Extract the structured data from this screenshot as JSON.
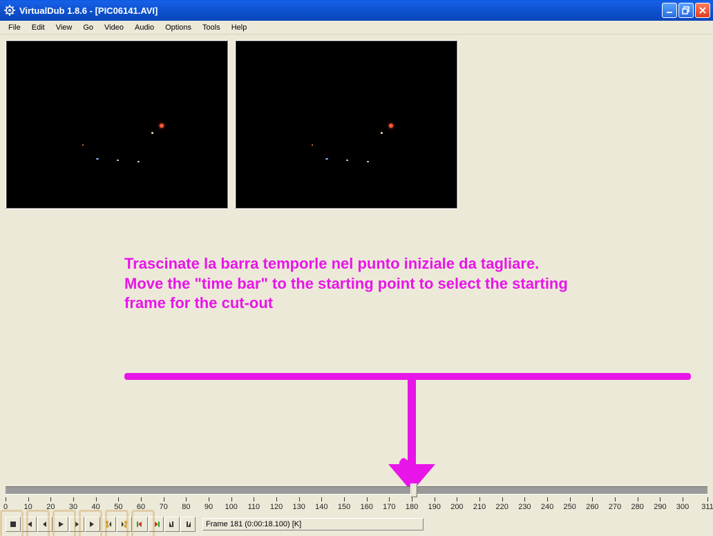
{
  "window": {
    "title": "VirtualDub 1.8.6 - [PIC06141.AVI]"
  },
  "menu": {
    "items": [
      "File",
      "Edit",
      "View",
      "Go",
      "Video",
      "Audio",
      "Options",
      "Tools",
      "Help"
    ]
  },
  "annotation": {
    "line1": "Trascinate la barra temporle nel punto iniziale da tagliare.",
    "line2": "Move the \"time bar\" to the starting point to select the starting",
    "line3": "frame for the cut-out",
    "color": "#e815e8"
  },
  "timeline": {
    "min": 0,
    "max": 311,
    "ticks": [
      0,
      10,
      20,
      30,
      40,
      50,
      60,
      70,
      80,
      90,
      100,
      110,
      120,
      130,
      140,
      150,
      160,
      170,
      180,
      190,
      200,
      210,
      220,
      230,
      240,
      250,
      260,
      270,
      280,
      290,
      300,
      311
    ],
    "current_frame": 181,
    "current_time": "0:00:18.100",
    "status_suffix": "[K]",
    "frame_display": "Frame 181 (0:00:18.100) [K]"
  },
  "toolbar": {
    "buttons": [
      {
        "name": "stop-icon",
        "title": "Stop"
      },
      {
        "name": "begin-icon",
        "title": "Go to beginning"
      },
      {
        "name": "back-icon",
        "title": "Step back"
      },
      {
        "name": "play-icon",
        "title": "Play"
      },
      {
        "name": "fwd-icon",
        "title": "Step forward"
      },
      {
        "name": "end-icon",
        "title": "Go to end"
      },
      {
        "name": "key-prev-icon",
        "title": "Previous keyframe"
      },
      {
        "name": "key-next-icon",
        "title": "Next keyframe"
      },
      {
        "name": "scene-prev-icon",
        "title": "Previous scene / drop"
      },
      {
        "name": "scene-next-icon",
        "title": "Next scene / drop"
      },
      {
        "name": "mark-in-icon",
        "title": "Set selection start"
      },
      {
        "name": "mark-out-icon",
        "title": "Set selection end"
      }
    ]
  }
}
